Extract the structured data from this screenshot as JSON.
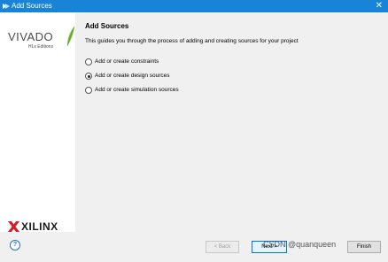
{
  "window": {
    "title": "Add Sources"
  },
  "sidebar": {
    "logo_text": "VIVADO",
    "edition_text": "HLx Editions",
    "vendor_text": "XILINX"
  },
  "main": {
    "heading": "Add Sources",
    "description": "This guides you through the process of adding and creating sources for your project",
    "options": [
      {
        "label": "Add or create constraints",
        "checked": false
      },
      {
        "label": "Add or create design sources",
        "checked": true
      },
      {
        "label": "Add or create simulation sources",
        "checked": false
      }
    ]
  },
  "footer": {
    "help_label": "?",
    "back_label": "< Back",
    "next_label": "Next >",
    "finish_label": "Finish",
    "watermark_text": "CSDN @quanqueen"
  },
  "colors": {
    "titlebar": "#1883d7",
    "accent": "#0078d7",
    "panel": "#f0f0f0"
  }
}
